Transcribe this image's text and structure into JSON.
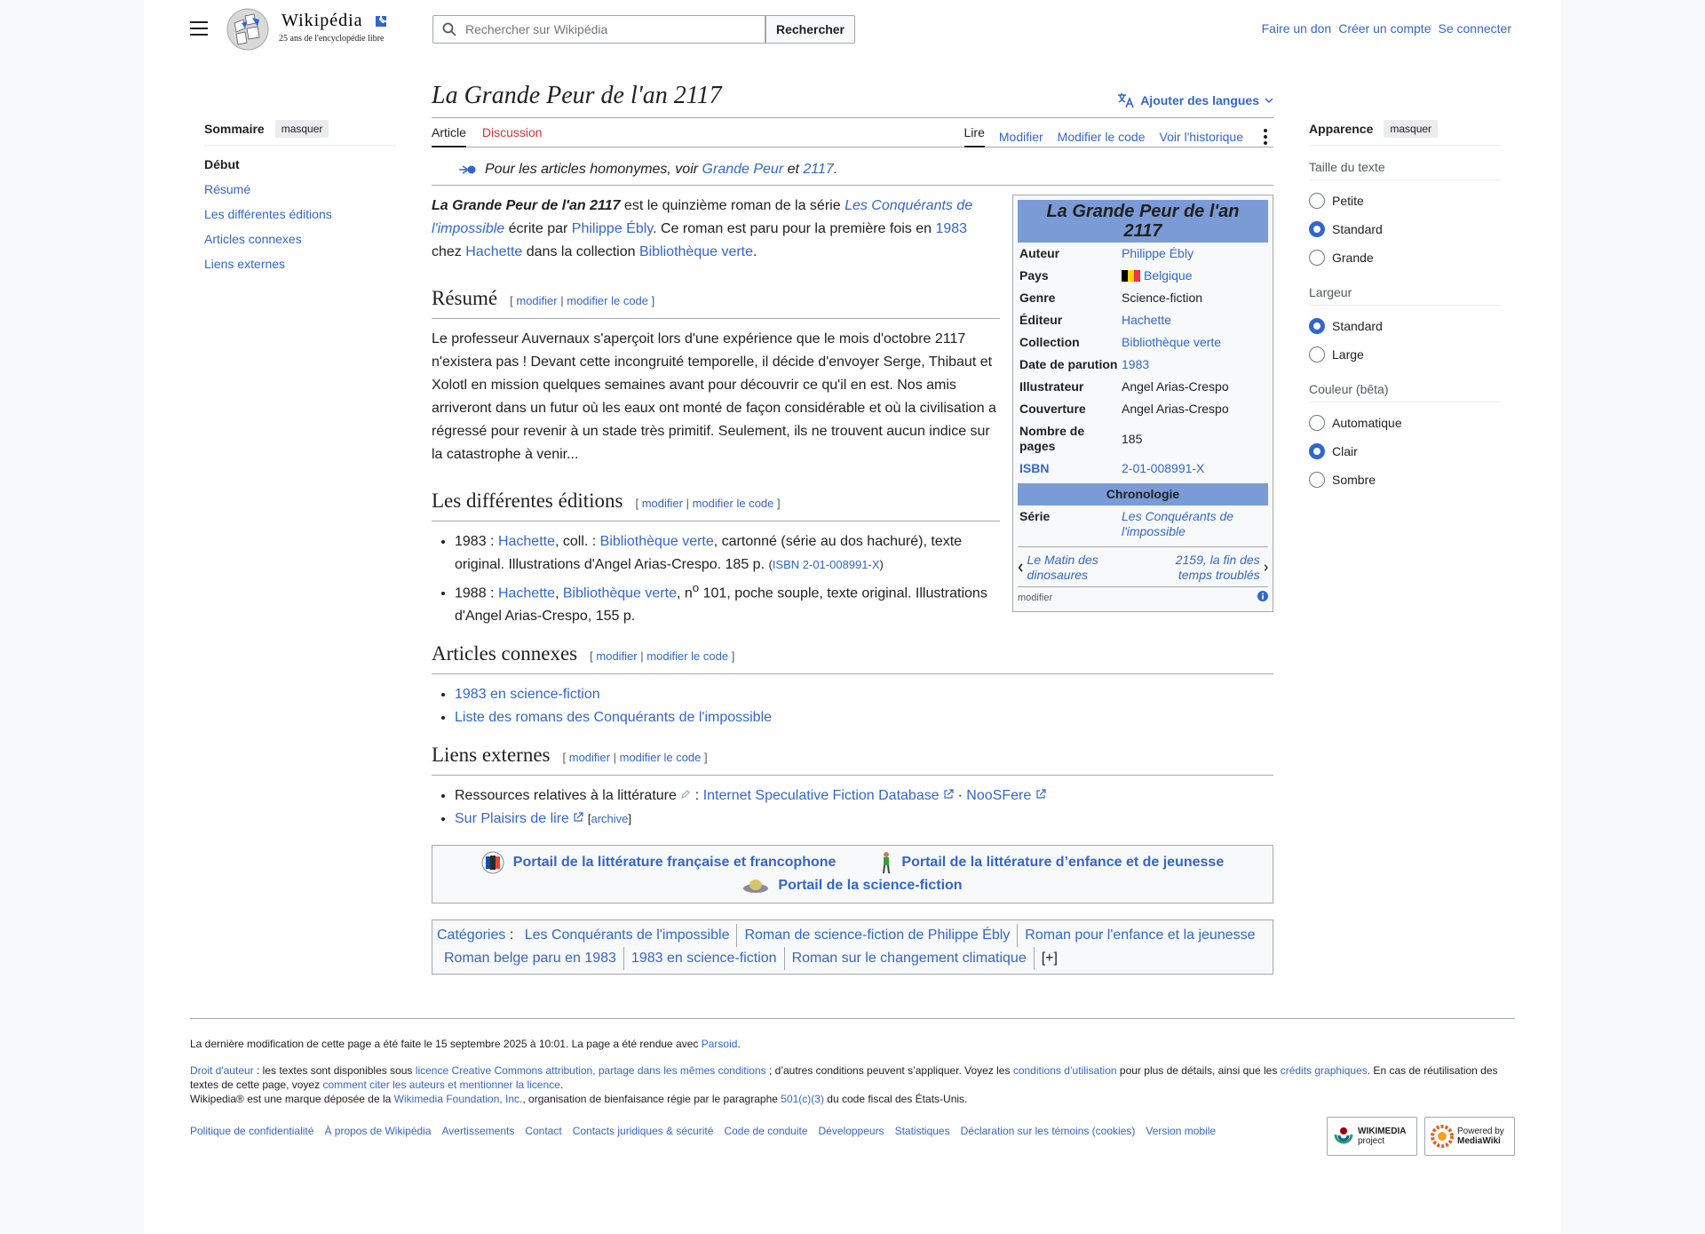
{
  "header": {
    "logo_word": "Wikipédia",
    "logo_tagline": "25 ans de l'encyclopédie libre",
    "search_placeholder": "Rechercher sur Wikipédia",
    "search_button": "Rechercher",
    "user_links": [
      "Faire un don",
      "Créer un compte",
      "Se connecter"
    ]
  },
  "toc": {
    "title": "Sommaire",
    "toggle": "masquer",
    "items": [
      "Début",
      "Résumé",
      "Les différentes éditions",
      "Articles connexes",
      "Liens externes"
    ]
  },
  "article": {
    "title": "La Grande Peur de l'an 2117",
    "add_languages": "Ajouter des langues",
    "tabs_left": [
      "Article",
      "Discussion"
    ],
    "tabs_right": [
      "Lire",
      "Modifier",
      "Modifier le code",
      "Voir l'historique"
    ],
    "hatnote": {
      "prefix": "Pour les articles homonymes, voir",
      "link1": "Grande Peur",
      "mid": "et",
      "link2": "2117",
      "suffix": "."
    },
    "intro": {
      "bold_title": "La Grande Peur de l'an 2117",
      "t1": " est le quinzième roman de la série ",
      "l_series": "Les Conquérants de l'impossible",
      "t2": " écrite par ",
      "l_author": "Philippe Ébly",
      "t3": ". Ce roman est paru pour la première fois en ",
      "l_year": "1983",
      "t4": " chez ",
      "l_publisher": "Hachette",
      "t5": " dans la collection ",
      "l_collection": "Bibliothèque verte",
      "t6": "."
    },
    "edit": {
      "open": "[",
      "modifier": "modifier",
      "sep": "|",
      "code": "modifier le code",
      "close": "]"
    },
    "sections": {
      "resume": "Résumé",
      "resume_text": "Le professeur Auvernaux s'aperçoit lors d'une expérience que le mois d'octobre 2117 n'existera pas ! Devant cette incongruité temporelle, il décide d'envoyer Serge, Thibaut et Xolotl en mission quelques semaines avant pour découvrir ce qu'il en est. Nos amis arriveront dans un futur où les eaux ont monté de façon considérable et où la civilisation a régressé pour revenir à un stade très primitif. Seulement, ils ne trouvent aucun indice sur la catastrophe à venir...",
      "editions": "Les différentes éditions",
      "ed1": {
        "a": "1983 : ",
        "l1": "Hachette",
        "b": ", coll. : ",
        "l2": "Bibliothèque verte",
        "c": ", cartonné (série au dos hachuré), texte original. Illustrations d'Angel Arias-Crespo. 185 p. ",
        "isbn_open": "(",
        "isbn": "ISBN 2-01-008991-X",
        "isbn_close": ")"
      },
      "ed2": {
        "a": "1988 : ",
        "l1": "Hachette",
        "b": ", ",
        "l2": "Bibliothèque verte",
        "c": ", n",
        "sup": "o",
        "d": " 101, poche souple, texte original. Illustrations d'Angel Arias-Crespo, 155 p."
      },
      "connexes": "Articles connexes",
      "connexes_items": [
        "1983 en science-fiction",
        "Liste des romans des Conquérants de l'impossible"
      ],
      "externes": "Liens externes",
      "ext1_text": "Ressources relatives à la littérature",
      "ext1_colon": " : ",
      "ext1_l1": "Internet Speculative Fiction Database",
      "ext1_dot": " · ",
      "ext1_l2": "NooSFere",
      "ext2_link": "Sur Plaisirs de lire",
      "ext2_archive": "archive"
    },
    "portals": [
      "Portail de la littérature française et francophone",
      "Portail de la littérature d’enfance et de jeunesse",
      "Portail de la science-fiction"
    ],
    "categories_label": "Catégories",
    "categories": [
      "Les Conquérants de l'impossible",
      "Roman de science-fiction de Philippe Ébly",
      "Roman pour l'enfance et la jeunesse",
      "Roman belge paru en 1983",
      "1983 en science-fiction",
      "Roman sur le changement climatique"
    ],
    "categories_more": "[+]"
  },
  "infobox": {
    "title": "La Grande Peur de l'an 2117",
    "rows": [
      {
        "k": "Auteur",
        "v": "Philippe Ébly"
      },
      {
        "k": "Pays",
        "v": "Belgique"
      },
      {
        "k": "Genre",
        "v": "Science-fiction"
      },
      {
        "k": "Éditeur",
        "v": "Hachette"
      },
      {
        "k": "Collection",
        "v": "Bibliothèque verte"
      },
      {
        "k": "Date de parution",
        "v": "1983"
      },
      {
        "k": "Illustrateur",
        "v": "Angel Arias-Crespo"
      },
      {
        "k": "Couverture",
        "v": "Angel Arias-Crespo"
      },
      {
        "k": "Nombre de pages",
        "v": "185"
      },
      {
        "k": "ISBN",
        "v": "2-01-008991-X"
      }
    ],
    "chrono": "Chronologie",
    "serie_k": "Série",
    "serie_v": "Les Conquérants de l'impossible",
    "prev": "Le Matin des dinosaures",
    "next": "2159, la fin des temps troublés",
    "foot": "modifier"
  },
  "appearance": {
    "title": "Apparence",
    "toggle": "masquer",
    "groups": [
      {
        "label": "Taille du texte",
        "options": [
          "Petite",
          "Standard",
          "Grande"
        ],
        "selected": "Standard"
      },
      {
        "label": "Largeur",
        "options": [
          "Standard",
          "Large"
        ],
        "selected": "Standard"
      },
      {
        "label": "Couleur (bêta)",
        "options": [
          "Automatique",
          "Clair",
          "Sombre"
        ],
        "selected": "Clair"
      }
    ]
  },
  "footer": {
    "last_mod": "La dernière modification de cette page a été faite le 15 septembre 2025 à 10:01. La page a été rendue avec ",
    "parsoid": "Parsoid",
    "parsoid_end": ".",
    "lic_a": "Droit d'auteur",
    "lic_b": " : les textes sont disponibles sous ",
    "lic_c": "licence Creative Commons attribution, partage dans les mêmes conditions",
    "lic_d": " ; d’autres conditions peuvent s’appliquer. Voyez les ",
    "lic_e": "conditions d’utilisation",
    "lic_f": " pour plus de détails, ainsi que les ",
    "lic_g": "crédits graphiques",
    "lic_h": ". En cas de réutilisation des textes de cette page, voyez ",
    "lic_i": "comment citer les auteurs et mentionner la licence",
    "lic_j": ".",
    "tm_a": "Wikipedia® est une marque déposée de la ",
    "tm_b": "Wikimedia Foundation, Inc.",
    "tm_c": ", organisation de bienfaisance régie par le paragraphe ",
    "tm_d": "501(c)(3)",
    "tm_e": " du code fiscal des États-Unis.",
    "links": [
      "Politique de confidentialité",
      "À propos de Wikipédia",
      "Avertissements",
      "Contact",
      "Contacts juridiques & sécurité",
      "Code de conduite",
      "Développeurs",
      "Statistiques",
      "Déclaration sur les témoins (cookies)",
      "Version mobile"
    ],
    "badge1": [
      "WIKIMEDIA",
      "project"
    ],
    "badge2": [
      "Powered by",
      "MediaWiki"
    ]
  }
}
